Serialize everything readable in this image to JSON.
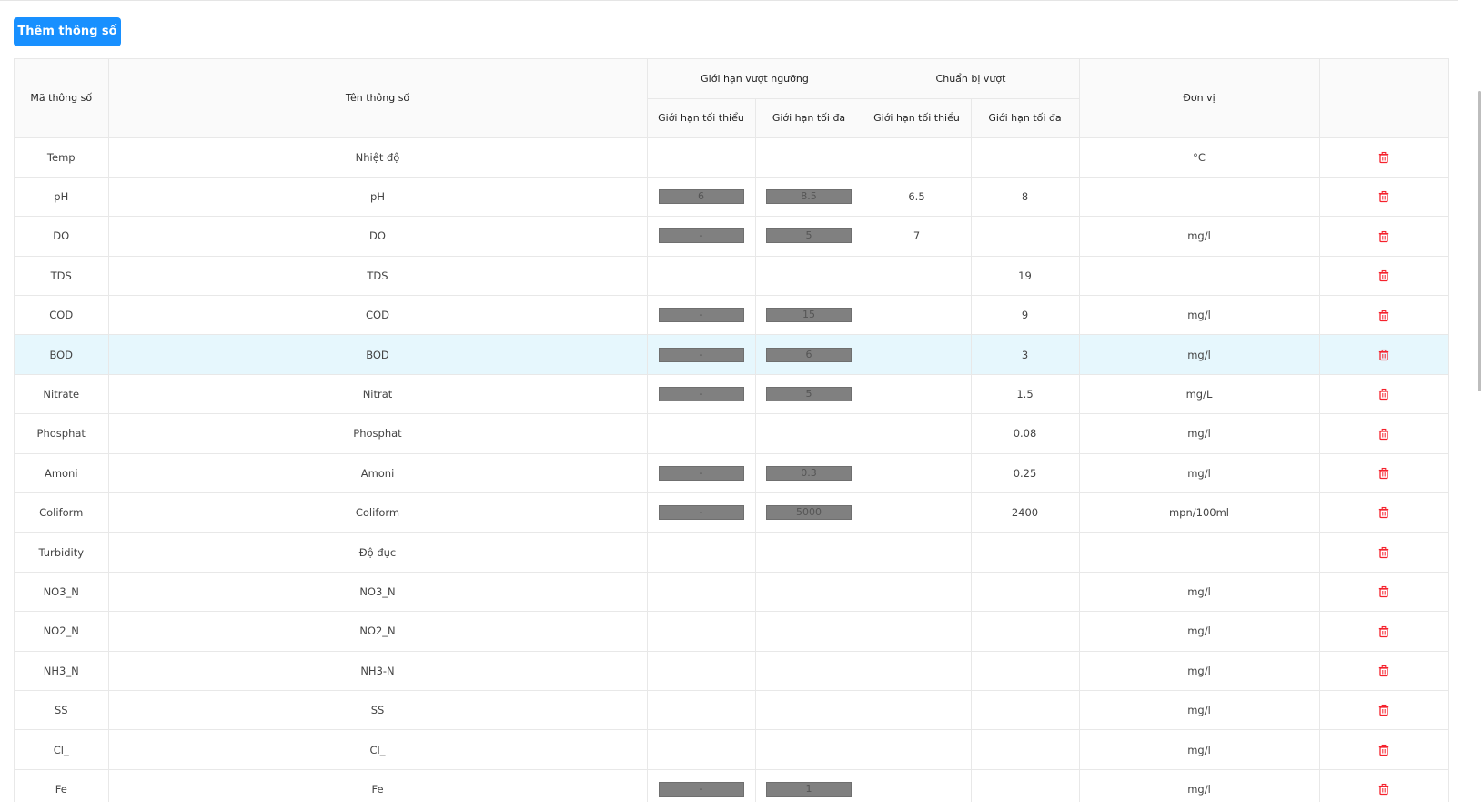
{
  "toolbar": {
    "add_label": "Thêm thông số"
  },
  "table": {
    "headers": {
      "code": "Mã thông số",
      "name": "Tên thông số",
      "threshold_group": "Giới hạn vượt ngưỡng",
      "prepare_group": "Chuẩn bị vượt",
      "min": "Giới hạn tối thiểu",
      "max": "Giới hạn tối đa",
      "unit": "Đơn vị"
    },
    "rows": [
      {
        "code": "Temp",
        "name": "Nhiệt độ",
        "thr_min": null,
        "thr_max": null,
        "prep_min": "",
        "prep_max": "",
        "unit": "°C"
      },
      {
        "code": "pH",
        "name": "pH",
        "thr_min": "6",
        "thr_max": "8.5",
        "prep_min": "6.5",
        "prep_max": "8",
        "unit": ""
      },
      {
        "code": "DO",
        "name": "DO",
        "thr_min": "-",
        "thr_max": "5",
        "prep_min": "7",
        "prep_max": "",
        "unit": "mg/l"
      },
      {
        "code": "TDS",
        "name": "TDS",
        "thr_min": null,
        "thr_max": null,
        "prep_min": "",
        "prep_max": "19",
        "unit": ""
      },
      {
        "code": "COD",
        "name": "COD",
        "thr_min": "-",
        "thr_max": "15",
        "prep_min": "",
        "prep_max": "9",
        "unit": "mg/l"
      },
      {
        "code": "BOD",
        "name": "BOD",
        "thr_min": "-",
        "thr_max": "6",
        "prep_min": "",
        "prep_max": "3",
        "unit": "mg/l",
        "highlight": true
      },
      {
        "code": "Nitrate",
        "name": "Nitrat",
        "thr_min": "-",
        "thr_max": "5",
        "prep_min": "",
        "prep_max": "1.5",
        "unit": "mg/L"
      },
      {
        "code": "Phosphat",
        "name": "Phosphat",
        "thr_min": null,
        "thr_max": null,
        "prep_min": "",
        "prep_max": "0.08",
        "unit": "mg/l"
      },
      {
        "code": "Amoni",
        "name": "Amoni",
        "thr_min": "-",
        "thr_max": "0.3",
        "prep_min": "",
        "prep_max": "0.25",
        "unit": "mg/l"
      },
      {
        "code": "Coliform",
        "name": "Coliform",
        "thr_min": "-",
        "thr_max": "5000",
        "prep_min": "",
        "prep_max": "2400",
        "unit": "mpn/100ml"
      },
      {
        "code": "Turbidity",
        "name": "Độ đục",
        "thr_min": null,
        "thr_max": null,
        "prep_min": "",
        "prep_max": "",
        "unit": ""
      },
      {
        "code": "NO3_N",
        "name": "NO3_N",
        "thr_min": null,
        "thr_max": null,
        "prep_min": "",
        "prep_max": "",
        "unit": "mg/l"
      },
      {
        "code": "NO2_N",
        "name": "NO2_N",
        "thr_min": null,
        "thr_max": null,
        "prep_min": "",
        "prep_max": "",
        "unit": "mg/l"
      },
      {
        "code": "NH3_N",
        "name": "NH3-N",
        "thr_min": null,
        "thr_max": null,
        "prep_min": "",
        "prep_max": "",
        "unit": "mg/l"
      },
      {
        "code": "SS",
        "name": "SS",
        "thr_min": null,
        "thr_max": null,
        "prep_min": "",
        "prep_max": "",
        "unit": "mg/l"
      },
      {
        "code": "Cl_",
        "name": "Cl_",
        "thr_min": null,
        "thr_max": null,
        "prep_min": "",
        "prep_max": "",
        "unit": "mg/l"
      },
      {
        "code": "Fe",
        "name": "Fe",
        "thr_min": "-",
        "thr_max": "1",
        "prep_min": "",
        "prep_max": "",
        "unit": "mg/l"
      }
    ]
  },
  "colors": {
    "primary": "#1890ff",
    "delete": "#f5222d",
    "row_highlight": "#e6f7fd",
    "header_bg": "#fafafa"
  },
  "icons": {
    "delete": "trash-icon"
  }
}
